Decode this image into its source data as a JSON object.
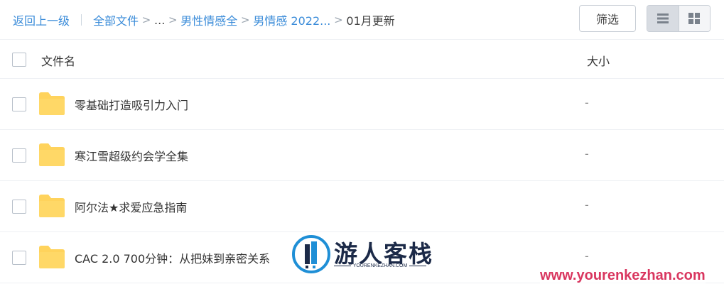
{
  "breadcrumb": {
    "back": "返回上一级",
    "items": [
      "全部文件",
      "...",
      "男性情感全",
      "男情感 2022...",
      "01月更新"
    ]
  },
  "toolbar": {
    "filter_label": "筛选",
    "view_modes": [
      "list-icon",
      "grid-icon"
    ],
    "active_view": "list"
  },
  "table": {
    "columns": [
      "文件名",
      "大小"
    ],
    "rows": [
      {
        "name": "零基础打造吸引力入门",
        "size": "-"
      },
      {
        "name": "寒江雪超级约会学全集",
        "size": "-"
      },
      {
        "name": "阿尔法★求爱应急指南",
        "size": "-"
      },
      {
        "name": "CAC 2.0 700分钟：从把妹到亲密关系",
        "size": "-"
      }
    ]
  },
  "watermark": {
    "title": "游人客栈",
    "subtitle": "YOURENKEZHAN.COM",
    "url": "www.yourenkezhan.com"
  },
  "colors": {
    "link": "#3b8cd9",
    "folder": "#ffd35c",
    "watermark_url": "#d9365f"
  }
}
